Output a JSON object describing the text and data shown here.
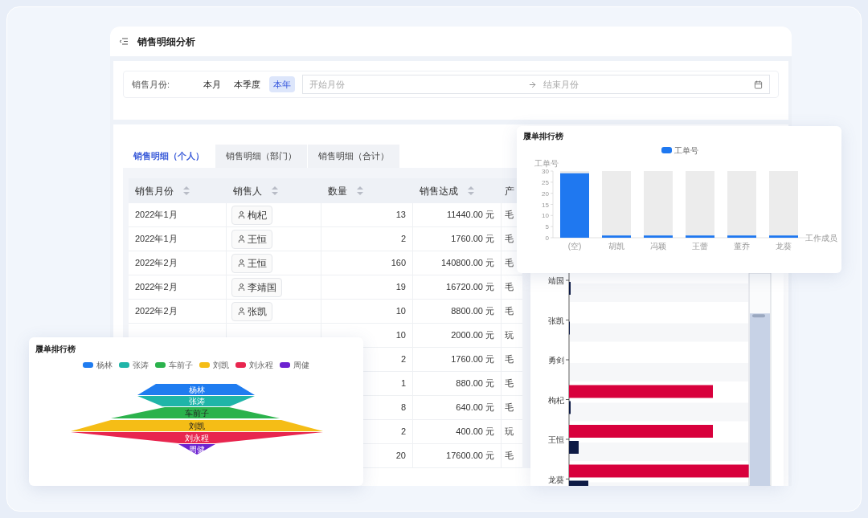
{
  "window": {
    "title": "销售明细分析"
  },
  "filter": {
    "label": "销售月份:",
    "options": [
      {
        "label": "本月",
        "selected": false
      },
      {
        "label": "本季度",
        "selected": false
      },
      {
        "label": "本年",
        "selected": true
      }
    ],
    "range": {
      "start_placeholder": "开始月份",
      "end_placeholder": "结束月份"
    }
  },
  "tabs": [
    {
      "label": "销售明细（个人）",
      "selected": true
    },
    {
      "label": "销售明细（部门）",
      "selected": false
    },
    {
      "label": "销售明细（合计）",
      "selected": false
    }
  ],
  "table": {
    "columns": [
      "销售月份",
      "销售人",
      "数量",
      "销售达成",
      "产"
    ],
    "rows": [
      {
        "month": "2022年1月",
        "person": "枸杞",
        "qty": "13",
        "amount": "11440.00 元",
        "product": "毛"
      },
      {
        "month": "2022年1月",
        "person": "王恒",
        "qty": "2",
        "amount": "1760.00 元",
        "product": "毛"
      },
      {
        "month": "2022年2月",
        "person": "王恒",
        "qty": "160",
        "amount": "140800.00 元",
        "product": "毛"
      },
      {
        "month": "2022年2月",
        "person": "李靖国",
        "qty": "19",
        "amount": "16720.00 元",
        "product": "毛"
      },
      {
        "month": "2022年2月",
        "person": "张凯",
        "qty": "10",
        "amount": "8800.00 元",
        "product": "毛"
      },
      {
        "qty": "10",
        "amount": "2000.00 元",
        "product": "玩"
      },
      {
        "qty": "2",
        "amount": "1760.00 元",
        "product": "毛"
      },
      {
        "qty": "1",
        "amount": "880.00 元",
        "product": "毛"
      },
      {
        "qty": "8",
        "amount": "640.00 元",
        "product": "毛"
      },
      {
        "qty": "2",
        "amount": "400.00 元",
        "product": "玩"
      },
      {
        "qty": "20",
        "amount": "17600.00 元",
        "product": "毛"
      }
    ]
  },
  "bar_card": {
    "title": "履单排行榜",
    "chart_data": {
      "type": "bar",
      "ylabel": "工单号",
      "xlabel": "工作成员",
      "categories": [
        "(空)",
        "胡凯",
        "冯颖",
        "王蕾",
        "董乔",
        "龙葵"
      ],
      "series": [
        {
          "name": "工单号",
          "color": "#1f78f0",
          "values": [
            29,
            1,
            1,
            1,
            1,
            1
          ]
        }
      ],
      "ylim": [
        0,
        30
      ],
      "yticks": [
        0,
        5,
        10,
        15,
        20,
        25,
        30
      ]
    }
  },
  "hbar_card": {
    "labels": [
      "靖国",
      "张凯",
      "勇剑",
      "枸杞",
      "王恒",
      "龙葵"
    ],
    "zoom_slider": {
      "level": 0.81
    }
  },
  "funnel_card": {
    "title": "履单排行榜",
    "legend": [
      {
        "label": "杨林",
        "color": "#1f7cf0"
      },
      {
        "label": "张涛",
        "color": "#1fb5a8"
      },
      {
        "label": "车前子",
        "color": "#2bb24c"
      },
      {
        "label": "刘凯",
        "color": "#f5bd16"
      },
      {
        "label": "刘永程",
        "color": "#e8264f"
      },
      {
        "label": "周健",
        "color": "#6c22d0"
      }
    ],
    "segments": [
      {
        "label": "杨林",
        "color": "#1f7cf0"
      },
      {
        "label": "张涛",
        "color": "#1fb5a8"
      },
      {
        "label": "车前子",
        "color": "#2bb24c"
      },
      {
        "label": "刘凯",
        "color": "#f5bd16"
      },
      {
        "label": "刘永程",
        "color": "#e8264f"
      },
      {
        "label": "周健",
        "color": "#6c22d0"
      }
    ]
  }
}
